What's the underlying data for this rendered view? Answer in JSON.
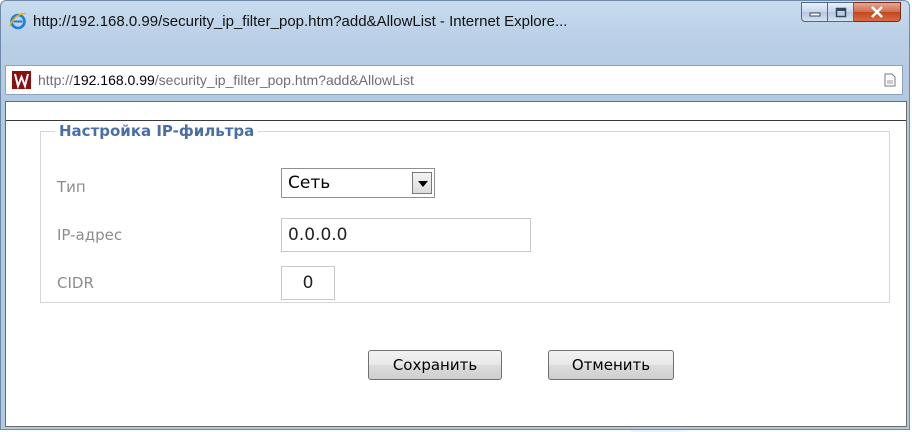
{
  "window": {
    "title": "http://192.168.0.99/security_ip_filter_pop.htm?add&AllowList - Internet Explore...",
    "controls": {
      "minimize": "minimize-icon",
      "maximize": "maximize-icon",
      "close": "close-icon"
    }
  },
  "address_bar": {
    "prefix": "http://",
    "host": "192.168.0.99",
    "path": "/security_ip_filter_pop.htm?add&AllowList"
  },
  "form": {
    "legend": "Настройка IP-фильтра",
    "type_label": "Тип",
    "type_value": "Сеть",
    "ip_label": "IP-адрес",
    "ip_value": "0.0.0.0",
    "cidr_label": "CIDR",
    "cidr_value": "0"
  },
  "buttons": {
    "save": "Сохранить",
    "cancel": "Отменить"
  },
  "colors": {
    "legend": "#4a6fa5",
    "label": "#8c8c8c",
    "close_button": "#c2471f"
  }
}
